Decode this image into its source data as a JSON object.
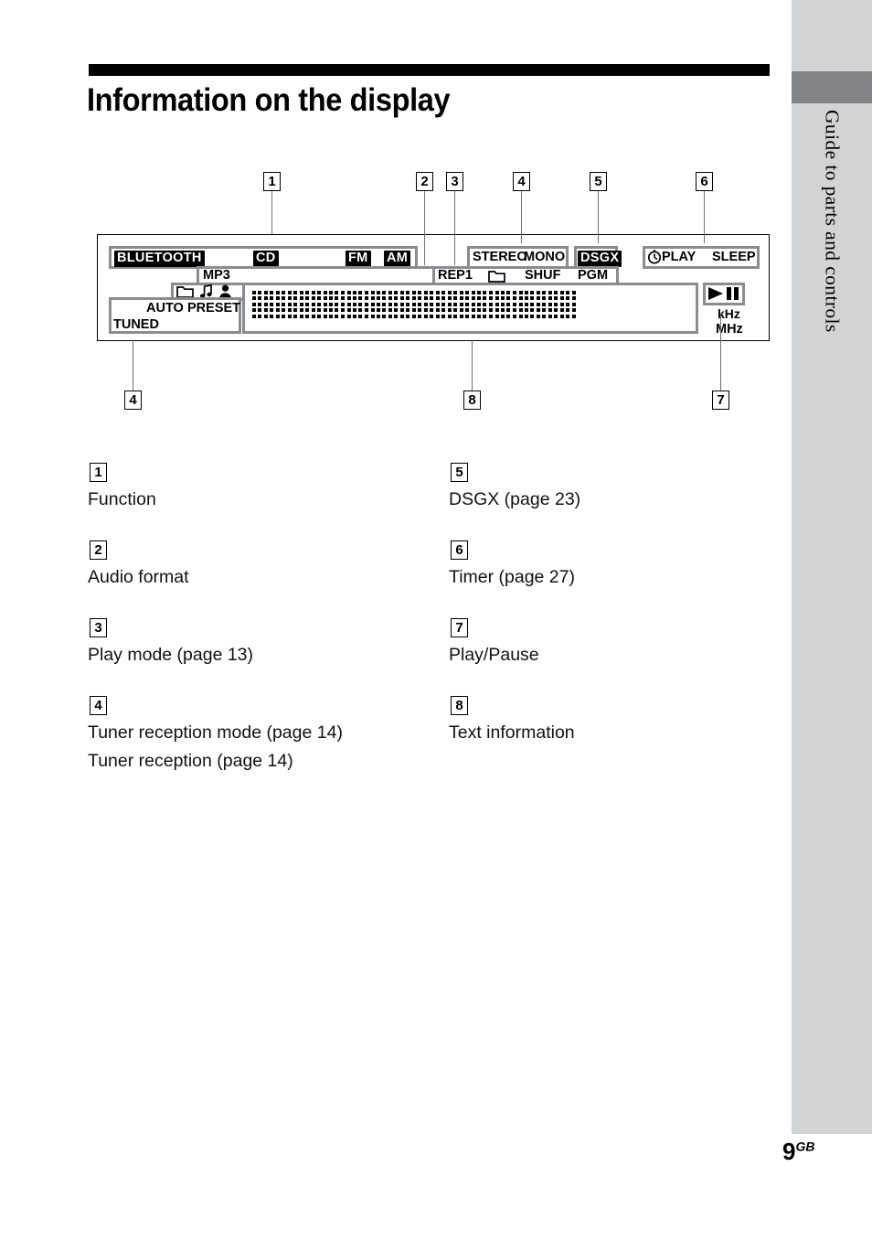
{
  "page": {
    "title": "Information on the display",
    "side_tab_label": "Guide to parts and controls",
    "number": "9",
    "number_suffix": "GB"
  },
  "display": {
    "top_row": [
      {
        "text": "BLUETOOTH",
        "style": "inverted"
      },
      {
        "text": "CD",
        "style": "inverted"
      },
      {
        "text": "FM",
        "style": "inverted"
      },
      {
        "text": "AM",
        "style": "inverted"
      },
      {
        "text": "STEREO",
        "style": "plain"
      },
      {
        "text": "MONO",
        "style": "plain"
      },
      {
        "text": "DSGX",
        "style": "inverted"
      },
      {
        "text": "PLAY",
        "style": "plain",
        "icon": "clock-icon"
      },
      {
        "text": "SLEEP",
        "style": "plain"
      }
    ],
    "second_row": [
      {
        "text": "MP3",
        "style": "plain"
      },
      {
        "text": "REP1",
        "style": "plain"
      },
      {
        "text": "",
        "style": "icon",
        "icon": "folder-icon"
      },
      {
        "text": "SHUF",
        "style": "plain"
      },
      {
        "text": "PGM",
        "style": "plain"
      }
    ],
    "third_row_icons": [
      "folder-icon",
      "music-note-icon",
      "person-icon"
    ],
    "tuner_box": [
      {
        "text": "AUTO"
      },
      {
        "text": "PRESET"
      },
      {
        "text": "TUNED"
      }
    ],
    "text_cells": 11,
    "right_indicators": {
      "transport": "play-pause-icon",
      "units": [
        "kHz",
        "MHz"
      ]
    }
  },
  "callouts_top": [
    {
      "n": "1"
    },
    {
      "n": "2"
    },
    {
      "n": "3"
    },
    {
      "n": "4"
    },
    {
      "n": "5"
    },
    {
      "n": "6"
    }
  ],
  "callouts_bottom": [
    {
      "n": "4"
    },
    {
      "n": "8"
    },
    {
      "n": "7"
    }
  ],
  "legend": {
    "left": [
      {
        "num": "1",
        "lines": [
          "Function"
        ]
      },
      {
        "num": "2",
        "lines": [
          "Audio format"
        ]
      },
      {
        "num": "3",
        "lines": [
          "Play mode (page 13)"
        ]
      },
      {
        "num": "4",
        "lines": [
          "Tuner reception mode (page 14)",
          "Tuner reception (page 14)"
        ]
      }
    ],
    "right": [
      {
        "num": "5",
        "lines": [
          "DSGX (page 23)"
        ]
      },
      {
        "num": "6",
        "lines": [
          "Timer (page 27)"
        ]
      },
      {
        "num": "7",
        "lines": [
          "Play/Pause"
        ]
      },
      {
        "num": "8",
        "lines": [
          "Text information"
        ]
      }
    ]
  }
}
